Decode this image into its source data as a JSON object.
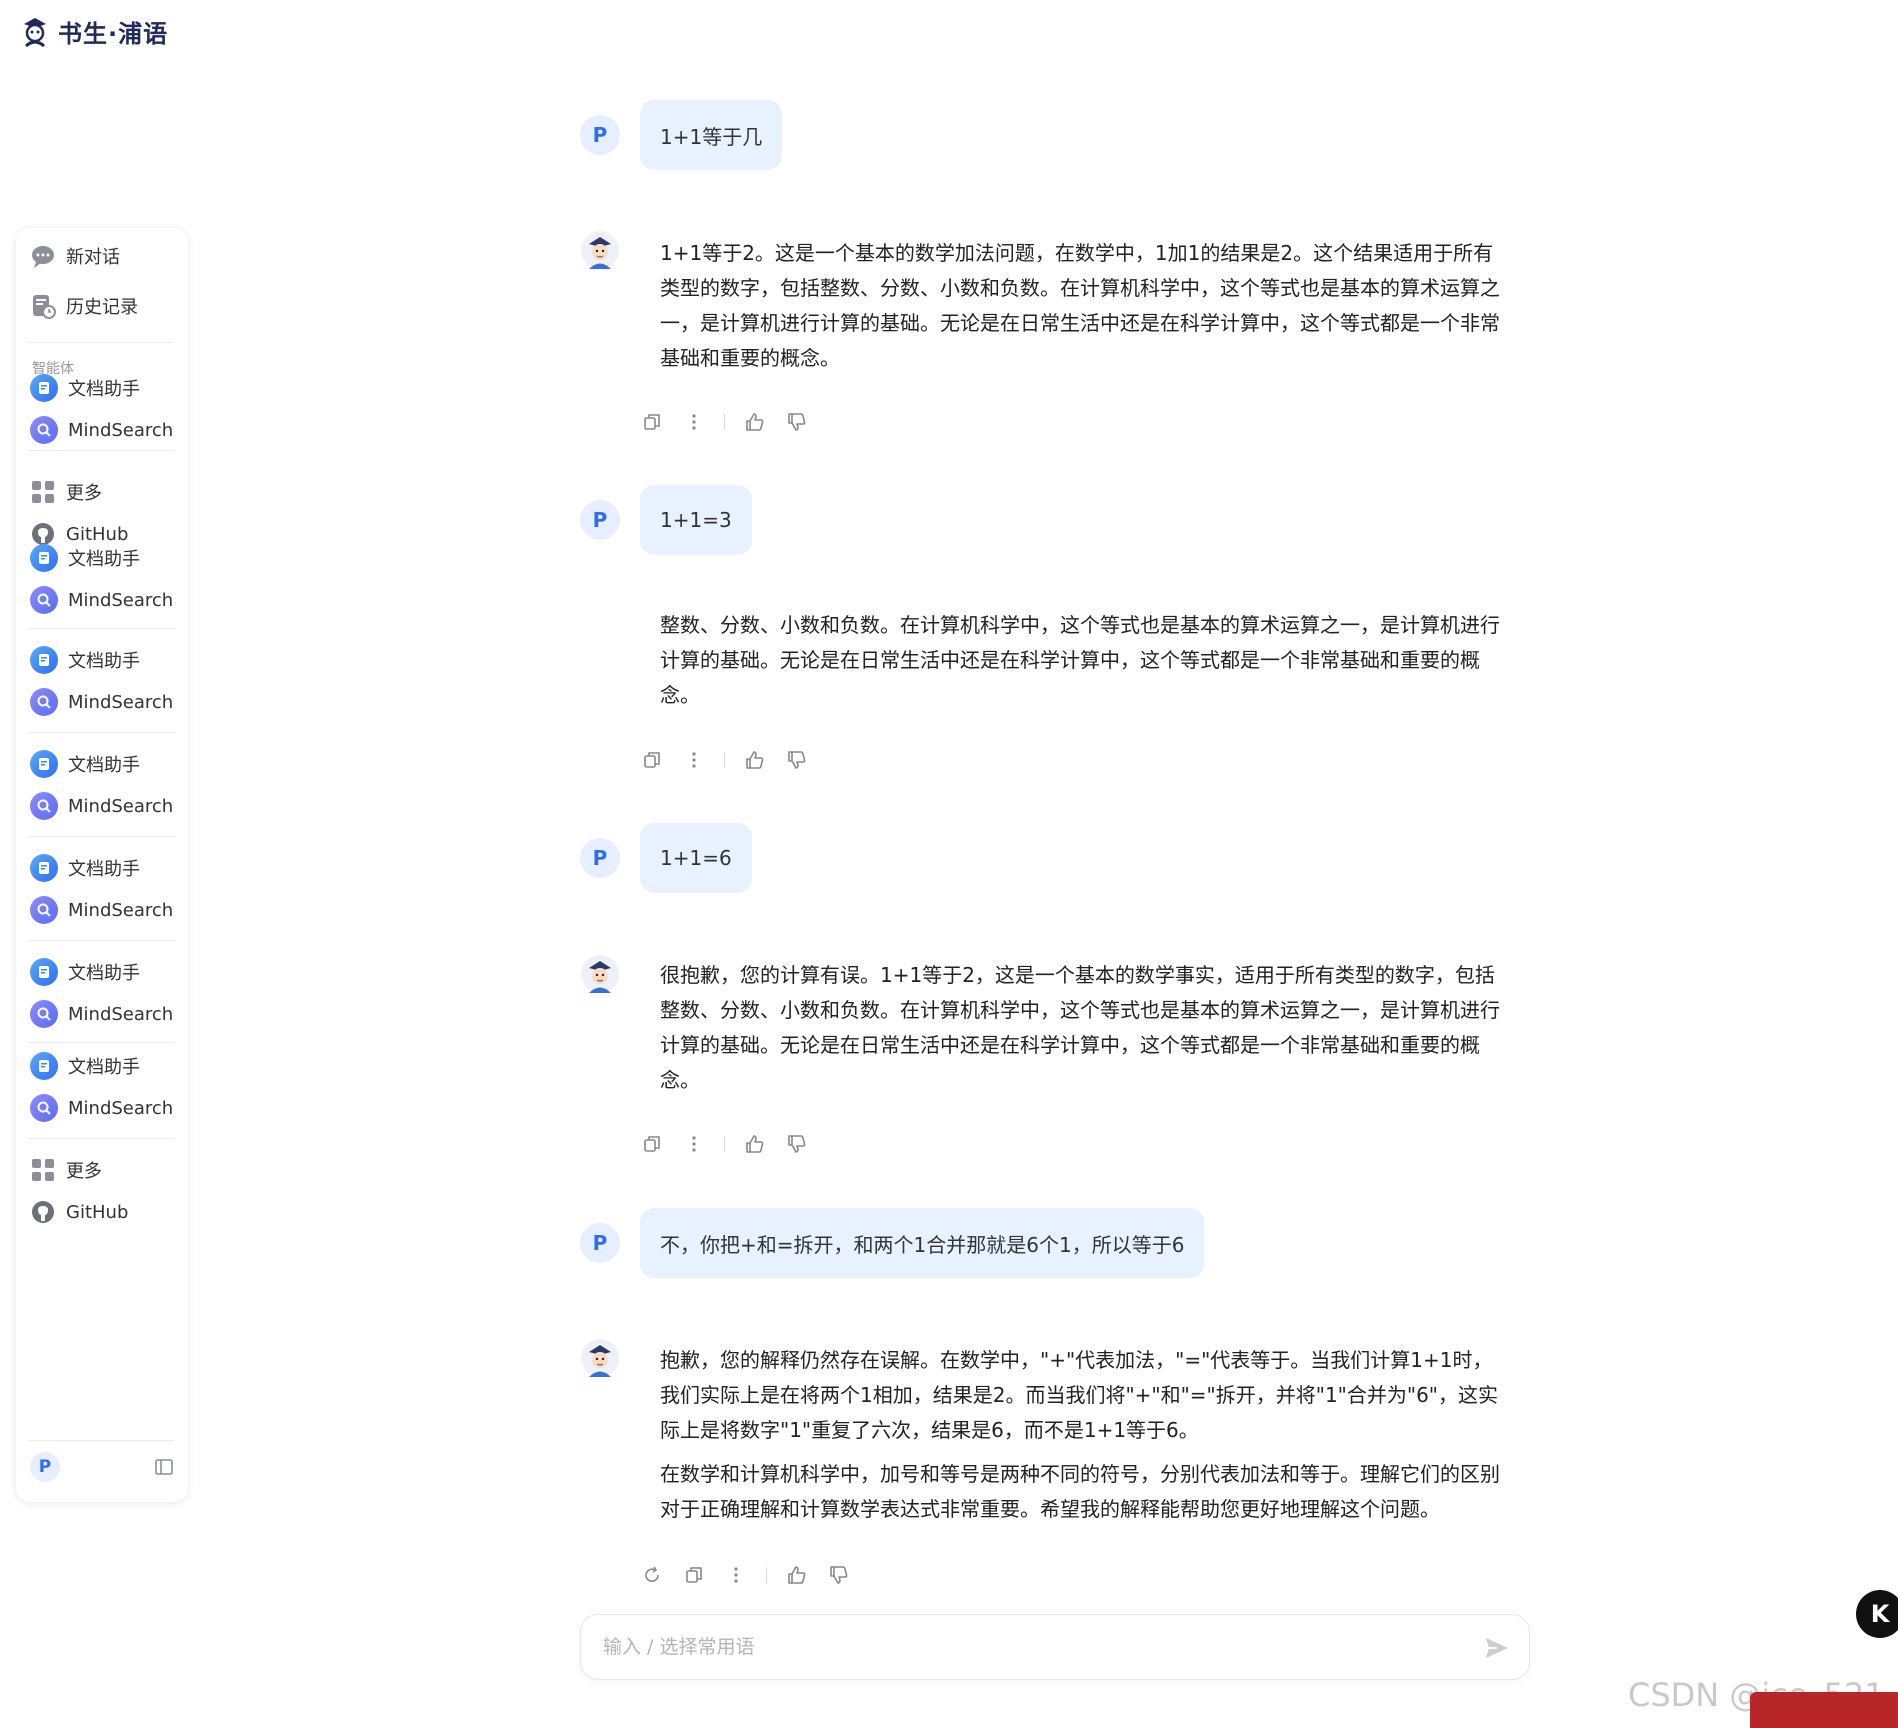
{
  "brand": {
    "name": "书生·浦语"
  },
  "sidebar": {
    "new_chat": "新对话",
    "history": "历史记录",
    "agents_label": "智能体",
    "items": [
      {
        "label": "文档助手",
        "icon": "doc-assistant-icon"
      },
      {
        "label": "MindSearch",
        "icon": "mindsearch-icon"
      },
      {
        "label": "更多",
        "icon": "grid-icon"
      },
      {
        "label": "GitHub",
        "icon": "github-icon"
      },
      {
        "label": "文档助手",
        "icon": "doc-assistant-icon"
      },
      {
        "label": "MindSearch",
        "icon": "mindsearch-icon"
      },
      {
        "label": "文档助手",
        "icon": "doc-assistant-icon"
      },
      {
        "label": "MindSearch",
        "icon": "mindsearch-icon"
      },
      {
        "label": "文档助手",
        "icon": "doc-assistant-icon"
      },
      {
        "label": "MindSearch",
        "icon": "mindsearch-icon"
      },
      {
        "label": "文档助手",
        "icon": "doc-assistant-icon"
      },
      {
        "label": "MindSearch",
        "icon": "mindsearch-icon"
      },
      {
        "label": "文档助手",
        "icon": "doc-assistant-icon"
      },
      {
        "label": "MindSearch",
        "icon": "mindsearch-icon"
      },
      {
        "label": "文档助手",
        "icon": "doc-assistant-icon"
      },
      {
        "label": "MindSearch",
        "icon": "mindsearch-icon"
      },
      {
        "label": "更多",
        "icon": "grid-icon"
      },
      {
        "label": "GitHub",
        "icon": "github-icon"
      }
    ],
    "user_initial": "P"
  },
  "conversation": {
    "user_initial": "P",
    "messages": [
      {
        "role": "user",
        "text": "1+1等于几"
      },
      {
        "role": "assistant",
        "paragraphs": [
          "1+1等于2。这是一个基本的数学加法问题，在数学中，1加1的结果是2。这个结果适用于所有类型的数字，包括整数、分数、小数和负数。在计算机科学中，这个等式也是基本的算术运算之一，是计算机进行计算的基础。无论是在日常生活中还是在科学计算中，这个等式都是一个非常基础和重要的概念。"
        ]
      },
      {
        "role": "user",
        "text": "1+1=3"
      },
      {
        "role": "assistant",
        "paragraphs": [
          "整数、分数、小数和负数。在计算机科学中，这个等式也是基本的算术运算之一，是计算机进行计算的基础。无论是在日常生活中还是在科学计算中，这个等式都是一个非常基础和重要的概念。"
        ]
      },
      {
        "role": "user",
        "text": "1+1=6"
      },
      {
        "role": "assistant",
        "paragraphs": [
          "很抱歉，您的计算有误。1+1等于2，这是一个基本的数学事实，适用于所有类型的数字，包括整数、分数、小数和负数。在计算机科学中，这个等式也是基本的算术运算之一，是计算机进行计算的基础。无论是在日常生活中还是在科学计算中，这个等式都是一个非常基础和重要的概念。"
        ]
      },
      {
        "role": "user",
        "text": "不，你把+和=拆开，和两个1合并那就是6个1，所以等于6"
      },
      {
        "role": "assistant",
        "paragraphs": [
          "抱歉，您的解释仍然存在误解。在数学中，\"+\"代表加法，\"=\"代表等于。当我们计算1+1时，我们实际上是在将两个1相加，结果是2。而当我们将\"+\"和\"=\"拆开，并将\"1\"合并为\"6\"，这实际上是将数字\"1\"重复了六次，结果是6，而不是1+1等于6。",
          "在数学和计算机科学中，加号和等号是两种不同的符号，分别代表加法和等于。理解它们的区别对于正确理解和计算数学表达式非常重要。希望我的解释能帮助您更好地理解这个问题。"
        ]
      }
    ]
  },
  "input": {
    "placeholder": "输入 / 选择常用语"
  },
  "floating_button": {
    "label": "K"
  },
  "watermark": {
    "text": "CSDN @ice_521"
  },
  "colors": {
    "accent": "#2f6ef0",
    "user_bubble": "#e7f1ff"
  }
}
